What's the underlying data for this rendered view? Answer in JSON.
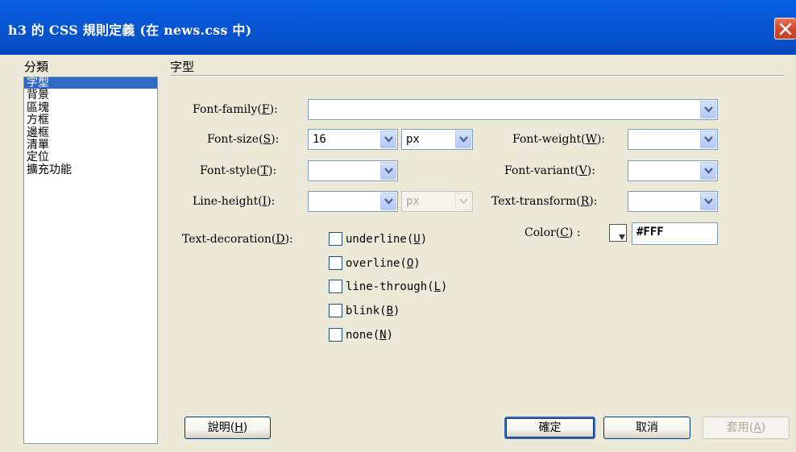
{
  "window": {
    "title": "h3 的 CSS 規則定義 (在 news.css 中)"
  },
  "sidebar": {
    "header": "分類",
    "items": [
      {
        "label": "字型",
        "selected": true
      },
      {
        "label": "背景",
        "selected": false
      },
      {
        "label": "區塊",
        "selected": false
      },
      {
        "label": "方框",
        "selected": false
      },
      {
        "label": "邊框",
        "selected": false
      },
      {
        "label": "清單",
        "selected": false
      },
      {
        "label": "定位",
        "selected": false
      },
      {
        "label": "擴充功能",
        "selected": false
      }
    ]
  },
  "panel": {
    "title": "字型",
    "font_family": {
      "label": "Font-family(",
      "key": "F",
      "suffix": "):",
      "value": ""
    },
    "font_size": {
      "label": "Font-size(",
      "key": "S",
      "suffix": "):",
      "value": "16",
      "unit": "px"
    },
    "font_weight": {
      "label": "Font-weight(",
      "key": "W",
      "suffix": "):",
      "value": ""
    },
    "font_style": {
      "label": "Font-style(",
      "key": "T",
      "suffix": "):",
      "value": ""
    },
    "font_variant": {
      "label": "Font-variant(",
      "key": "V",
      "suffix": "):",
      "value": ""
    },
    "line_height": {
      "label": "Line-height(",
      "key": "I",
      "suffix": "):",
      "value": "",
      "unit": "px"
    },
    "text_transform": {
      "label": "Text-transform(",
      "key": "R",
      "suffix": "):",
      "value": ""
    },
    "color": {
      "label": "Color(",
      "key": "C",
      "suffix": ") :",
      "value": "#FFF",
      "swatch": "#FFFFFF"
    },
    "text_decoration": {
      "label": "Text-decoration(",
      "key": "D",
      "suffix": "):",
      "options": [
        {
          "label": "underline(",
          "key": "U",
          "suffix": ")",
          "checked": false
        },
        {
          "label": "overline(",
          "key": "O",
          "suffix": ")",
          "checked": false
        },
        {
          "label": "line-through(",
          "key": "L",
          "suffix": ")",
          "checked": false
        },
        {
          "label": "blink(",
          "key": "B",
          "suffix": ")",
          "checked": false
        },
        {
          "label": "none(",
          "key": "N",
          "suffix": ")",
          "checked": false
        }
      ]
    }
  },
  "buttons": {
    "help": {
      "label": "說明(",
      "key": "H",
      "suffix": ")"
    },
    "ok": {
      "label": "確定"
    },
    "cancel": {
      "label": "取消"
    },
    "apply": {
      "label": "套用(",
      "key": "A",
      "suffix": ")"
    }
  },
  "colors": {
    "titlebar": "#0553CF",
    "selection": "#316AC5",
    "dialog_bg": "#ECE9D8",
    "close_button": "#D34A2A"
  }
}
